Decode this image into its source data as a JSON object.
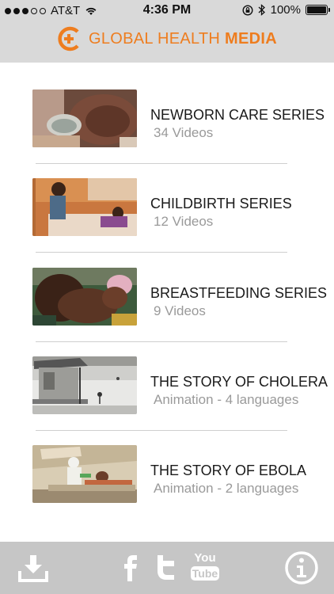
{
  "status_bar": {
    "carrier": "AT&T",
    "time": "4:36 PM",
    "battery": "100%"
  },
  "header": {
    "brand_part1": "GLOBAL HEALTH ",
    "brand_part2": "MEDIA",
    "brand_color": "#ee7d1f"
  },
  "series": [
    {
      "title": "NEWBORN CARE SERIES",
      "subtitle": "34 Videos",
      "thumbnail": "newborn-thumbnail"
    },
    {
      "title": "CHILDBIRTH SERIES",
      "subtitle": "12 Videos",
      "thumbnail": "childbirth-thumbnail"
    },
    {
      "title": "BREASTFEEDING SERIES",
      "subtitle": "9 Videos",
      "thumbnail": "breastfeeding-thumbnail"
    },
    {
      "title": "THE STORY OF CHOLERA",
      "subtitle": "Animation - 4 languages",
      "thumbnail": "cholera-thumbnail"
    },
    {
      "title": "THE STORY OF EBOLA",
      "subtitle": "Animation - 2 languages",
      "thumbnail": "ebola-thumbnail"
    }
  ],
  "bottom_bar": {
    "youtube_label_top": "You",
    "youtube_label_bottom": "Tube",
    "icons": [
      "download-icon",
      "facebook-icon",
      "twitter-icon",
      "youtube-icon",
      "info-icon"
    ]
  }
}
